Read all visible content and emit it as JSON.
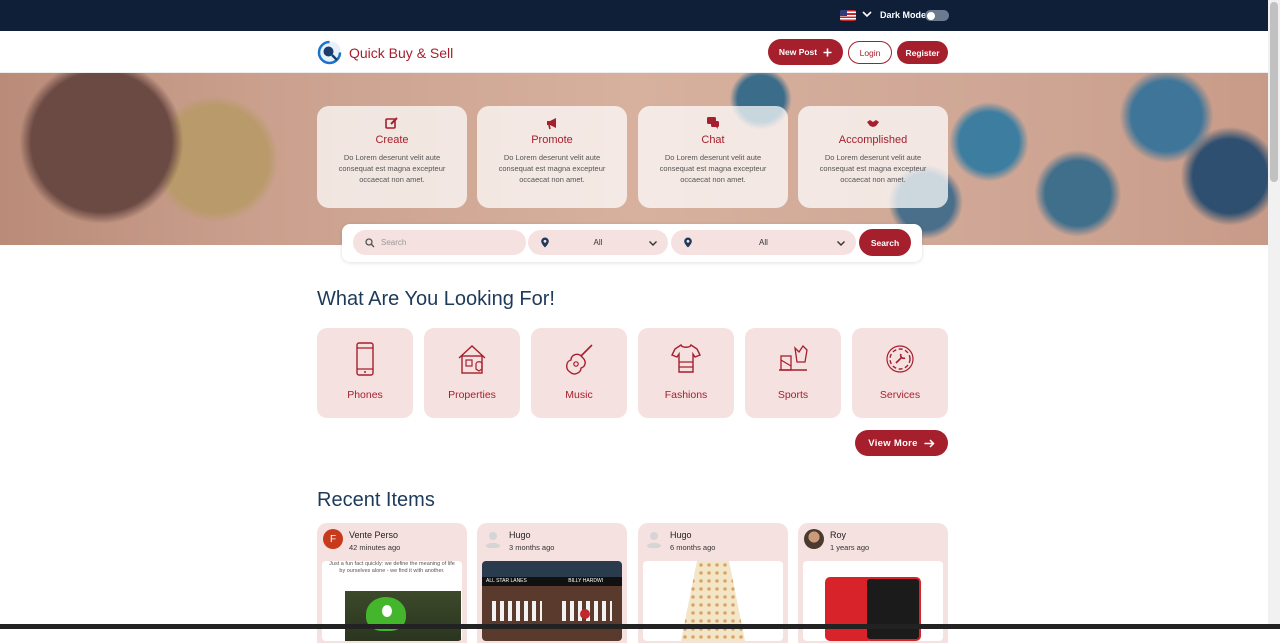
{
  "topbar": {
    "language_flag": "us-flag-icon",
    "dark_mode_label": "Dark Mode",
    "dark_mode_on": false
  },
  "header": {
    "brand": "Quick Buy & Sell",
    "new_post_label": "New Post",
    "login_label": "Login",
    "register_label": "Register"
  },
  "hero": {
    "cards": [
      {
        "title": "Create",
        "icon": "edit-icon",
        "desc": "Do Lorem deserunt velit aute consequat est magna excepteur occaecat non amet."
      },
      {
        "title": "Promote",
        "icon": "megaphone-icon",
        "desc": "Do Lorem deserunt velit aute consequat est magna excepteur occaecat non amet."
      },
      {
        "title": "Chat",
        "icon": "chat-icon",
        "desc": "Do Lorem deserunt velit aute consequat est magna excepteur occaecat non amet."
      },
      {
        "title": "Accomplished",
        "icon": "handshake-icon",
        "desc": "Do Lorem deserunt velit aute consequat est magna excepteur occaecat non amet."
      }
    ]
  },
  "search": {
    "placeholder": "Search",
    "location1": "All",
    "location2": "All",
    "button_label": "Search"
  },
  "categories": {
    "title": "What Are You Looking For!",
    "items": [
      {
        "label": "Phones",
        "icon": "phone-icon"
      },
      {
        "label": "Properties",
        "icon": "house-icon"
      },
      {
        "label": "Music",
        "icon": "guitar-icon"
      },
      {
        "label": "Fashions",
        "icon": "clothes-icon"
      },
      {
        "label": "Sports",
        "icon": "sports-icon"
      },
      {
        "label": "Services",
        "icon": "gear-icon"
      }
    ],
    "view_more_label": "View More"
  },
  "recent": {
    "title": "Recent Items",
    "items": [
      {
        "user": "Vente Perso",
        "time": "42 minutes ago",
        "avatar_letter": "F",
        "caption": "Just a fun fact quickly: we define the meaning of life by ourselves alone - we find it with another."
      },
      {
        "user": "Hugo",
        "time": "3 months ago",
        "sign_left": "ALL STAR LANES",
        "sign_right": "BILLY HARDWI"
      },
      {
        "user": "Hugo",
        "time": "6 months ago"
      },
      {
        "user": "Roy",
        "time": "1 years ago"
      }
    ]
  },
  "colors": {
    "brand": "#a51f2d",
    "topbar": "#0f1f37",
    "card_bg": "#f6e1e1",
    "heading": "#1e3a5a"
  }
}
